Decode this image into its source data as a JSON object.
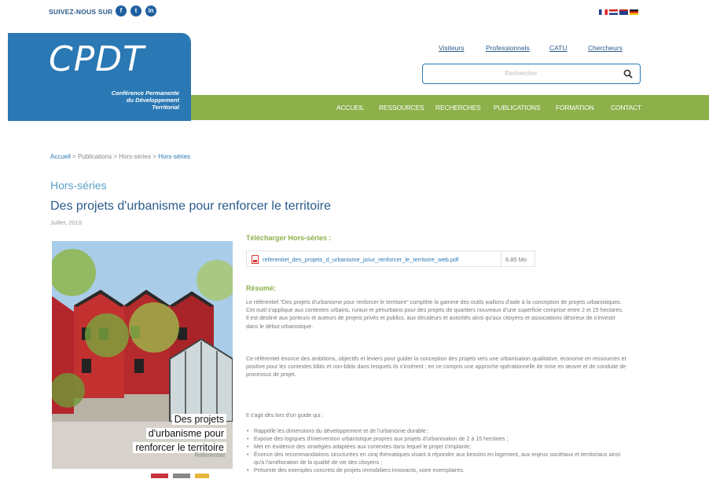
{
  "header": {
    "follow_label": "SUIVEZ-NOUS SUR",
    "social": [
      {
        "name": "facebook",
        "glyph": "f"
      },
      {
        "name": "twitter",
        "glyph": "t"
      },
      {
        "name": "linkedin",
        "glyph": "in"
      }
    ],
    "flags": [
      "fr",
      "nl",
      "en",
      "de"
    ],
    "logo_text": "CPDT",
    "logo_subtitle": [
      "Conférence Permanente",
      "du Développement",
      "Territorial"
    ],
    "top_links": [
      "Visiteurs",
      "Professionnels",
      "CATU",
      "Chercheurs"
    ],
    "search_placeholder": "Rechercher"
  },
  "nav": [
    "ACCUEIL",
    "RESSOURCES",
    "RECHERCHES",
    "PUBLICATIONS",
    "FORMATION",
    "CONTACT"
  ],
  "breadcrumb": {
    "items": [
      "Accueil",
      "Publications",
      "Hors-séries",
      "Hors-séries"
    ],
    "separator": ">"
  },
  "section_title": "Hors-séries",
  "title": "Des projets d'urbanisme pour renforcer le territoire",
  "date": "Juillet, 2019",
  "cover": {
    "title_lines": [
      "Des projets",
      "d'urbanisme pour",
      "renforcer le territoire"
    ],
    "subtitle": "Référentiel"
  },
  "download": {
    "label": "Télécharger Hors-séries :",
    "file": "referentiel_des_projets_d_urbanisme_pour_renforcer_le_territoire_web.pdf",
    "size": "6.85 Mo"
  },
  "resume": {
    "label": "Résumé:",
    "p1": "Le référentiel \"Des projets d'urbanisme pour renforcer le territoire\" complète la gamme des outils wallons d'aide à la conception de projets urbanistiques. Cet outil s'applique aux contextes urbains, ruraux et périurbains pour des projets de quartiers nouveaux d'une superficie comprise entre 2 et 15 hectares. Il est destiné aux porteurs et auteurs de projets privés et publics, aux décideurs et autorités ainsi qu'aux citoyens et associations désireux de s'investir dans le début urbanistique.",
    "p2": "Ce référentiel énonce des ambitions, objectifs et leviers pour guider la conception des projets vers une urbanisation qualitative, économe en ressources et positive pour les contextes bâtis et non-bâtis dans lesquels ils s'insèrent ; en ce compris une approche opérationnelle de mise en œuvre et de conduite de processus de projet.",
    "p3": "Il s'agit dès lors d'un guide qui :",
    "bullets": [
      "Rappelle les dimensions du développement et de l'urbanisme durable ;",
      "Expose des logiques d'intervention urbanistique propres aux projets d'urbanisation de 2 à 15 hectares ;",
      "Met en évidence des stratégies adaptées aux contextes dans lequel le projet s'implante;",
      "Énonce des recommandations structurées en cinq thématiques visant à répondre aux besoins en logement, aux enjeux sociétaux et territoriaux ainsi qu'à l'amélioration de la qualité de vie des citoyens ;",
      "Présente des exemples concrets de projets immobiliers innovants, voire exemplaires."
    ]
  },
  "colors": {
    "brand_blue": "#2a78b4",
    "nav_green": "#8cb04a",
    "title_blue": "#2a5a8a",
    "section_blue": "#5a9fc6"
  }
}
